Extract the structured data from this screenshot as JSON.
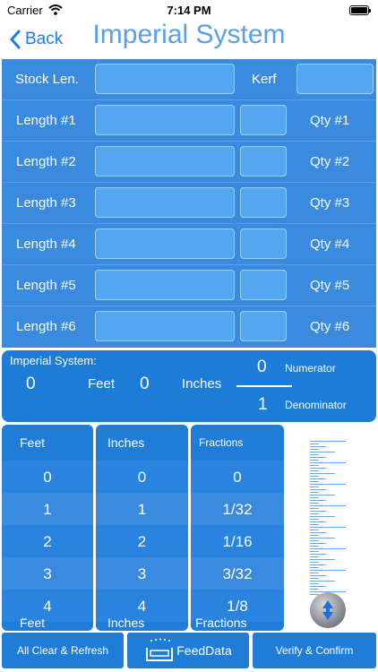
{
  "status": {
    "carrier": "Carrier",
    "time": "7:14 PM"
  },
  "nav": {
    "back": "Back",
    "title": "Imperial System"
  },
  "form": {
    "stock_label": "Stock Len.",
    "kerf_label": "Kerf",
    "rows": [
      {
        "length": "Length #1",
        "qty": "Qty #1"
      },
      {
        "length": "Length #2",
        "qty": "Qty #2"
      },
      {
        "length": "Length #3",
        "qty": "Qty #3"
      },
      {
        "length": "Length #4",
        "qty": "Qty #4"
      },
      {
        "length": "Length #5",
        "qty": "Qty #5"
      },
      {
        "length": "Length #6",
        "qty": "Qty #6"
      }
    ]
  },
  "display": {
    "heading": "Imperial System:",
    "feet_value": "0",
    "feet_label": "Feet",
    "inches_value": "0",
    "inches_label": "Inches",
    "numerator_value": "0",
    "numerator_label": "Numerator",
    "denominator_value": "1",
    "denominator_label": "Denominator"
  },
  "pickers": {
    "feet": {
      "header": "Feet",
      "footer": "Feet",
      "values": [
        "0",
        "1",
        "2",
        "3",
        "4"
      ]
    },
    "inches": {
      "header": "Inches",
      "footer": "Inches",
      "values": [
        "0",
        "1",
        "2",
        "3",
        "4"
      ]
    },
    "fractions": {
      "header": "Fractions",
      "footer": "Fractions",
      "values": [
        "0",
        "1/32",
        "1/16",
        "3/32",
        "1/8"
      ]
    }
  },
  "buttons": {
    "clear": "All Clear & Refresh",
    "feed": "FeedData",
    "verify": "Verify & Confirm"
  },
  "colors": {
    "accent": "#1d7cf2",
    "panel": "#3a8be0",
    "dark_panel": "#1c7cd8"
  }
}
